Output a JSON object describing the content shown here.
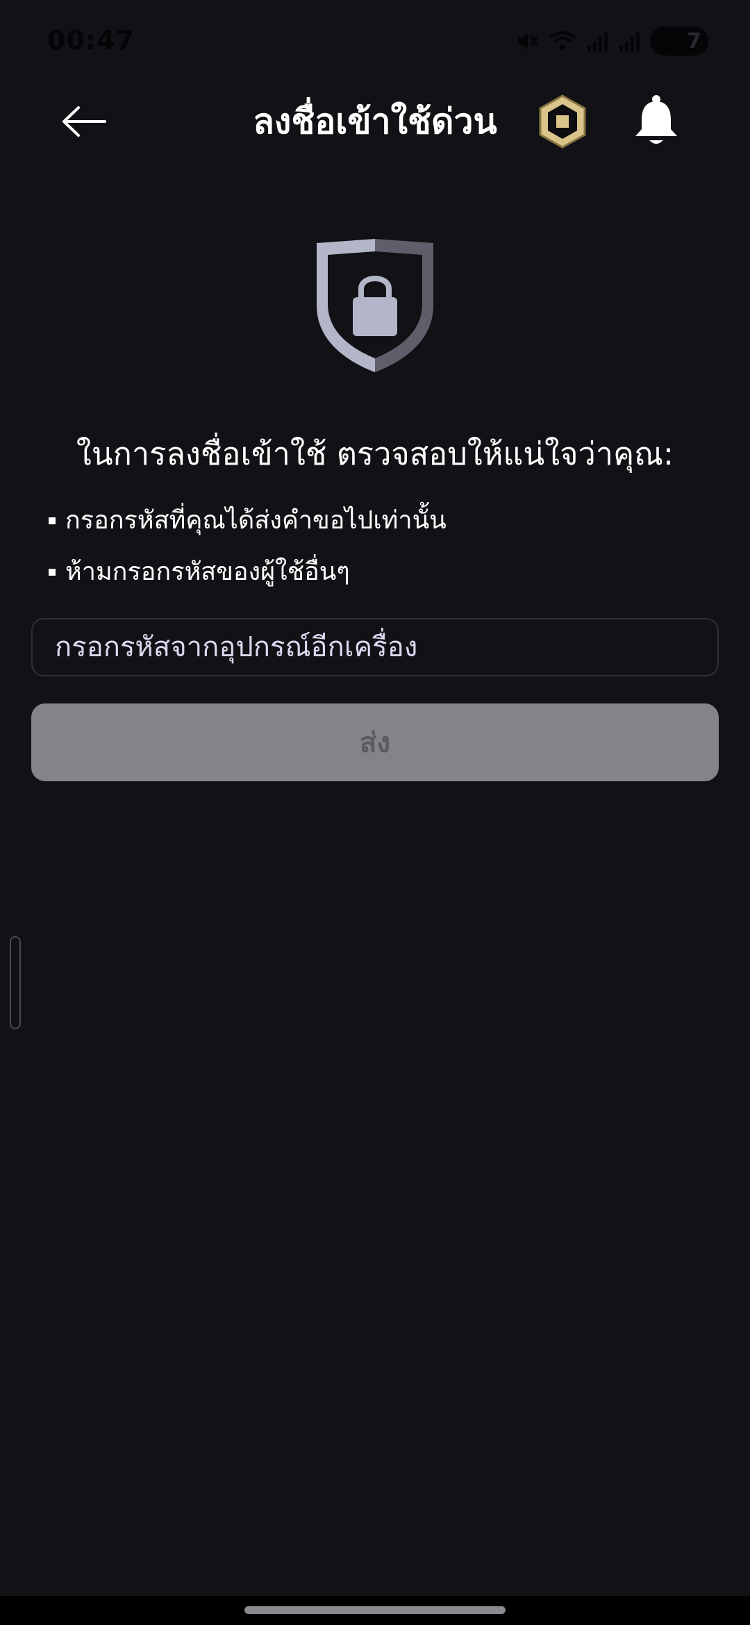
{
  "status_bar": {
    "time": "00:47",
    "battery": "7",
    "icons": [
      "mute-icon",
      "wifi-icon",
      "signal-icon",
      "signal-icon",
      "battery-icon"
    ]
  },
  "header": {
    "title": "ลงชื่อเข้าใช้ด่วน",
    "back_icon": "back-arrow-icon",
    "robux_icon": "robux-icon",
    "bell_icon": "bell-icon"
  },
  "main": {
    "shield_icon": "shield-lock-icon",
    "heading": "ในการลงชื่อเข้าใช้ ตรวจสอบให้แน่ใจว่าคุณ:",
    "rules": [
      "กรอกรหัสที่คุณได้ส่งคำขอไปเท่านั้น",
      "ห้ามกรอกรหัสของผู้ใช้อื่นๆ"
    ],
    "input": {
      "placeholder": "กรอกรหัสจากอุปกรณ์อีกเครื่อง",
      "value": ""
    },
    "submit_label": "ส่ง"
  },
  "colors": {
    "background": "#121216",
    "button_disabled": "#838389",
    "button_text": "#5a5a60",
    "robux_gold": "#d9c48a"
  }
}
